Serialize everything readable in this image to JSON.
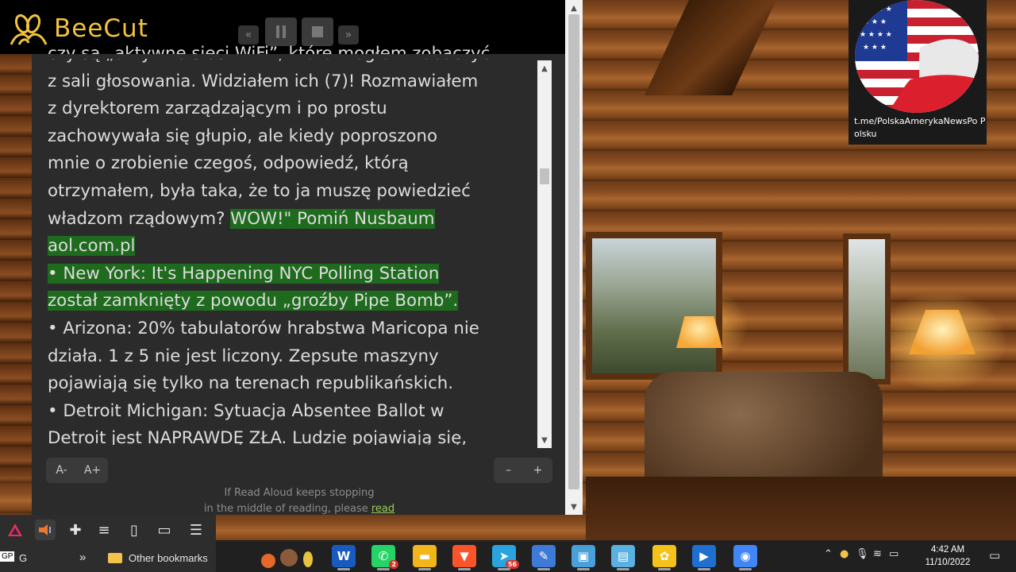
{
  "recorder": {
    "app_name": "BeeCut",
    "controls": [
      "rewind",
      "pause",
      "stop",
      "forward"
    ]
  },
  "reader": {
    "lines": [
      {
        "text": "czy są „aktywne sieci WiFi”, które mogłem zobaczyć",
        "highlight": false
      },
      {
        "text": "z sali głosowania. Widziałem ich (7)! Rozmawiałem",
        "highlight": false
      },
      {
        "text": "z dyrektorem zarządzającym i po prostu",
        "highlight": false
      },
      {
        "text": "zachowywała się głupio, ale kiedy poproszono",
        "highlight": false
      },
      {
        "text": "mnie o zrobienie czegoś, odpowiedź, którą",
        "highlight": false
      },
      {
        "text": "otrzymałem, była taka, że to ja muszę powiedzieć",
        "highlight": false
      },
      {
        "text_plain": "władzom rządowym? ",
        "text_hl": "WOW!\" Pomiń Nusbaum",
        "mixed": true
      },
      {
        "text": "aol.com.pl",
        "highlight": true
      },
      {
        "text": "• New York: It's Happening NYC Polling Station",
        "highlight": true
      },
      {
        "text": "został zamknięty z powodu „groźby Pipe Bomb”.",
        "highlight": true
      },
      {
        "text": "• Arizona: 20% tabulatorów hrabstwa Maricopa nie",
        "highlight": false
      },
      {
        "text": "działa. 1 z 5 nie jest liczony. Zepsute maszyny",
        "highlight": false
      },
      {
        "text": "pojawiają się tylko na terenach republikańskich.",
        "highlight": false
      },
      {
        "text": "• Detroit Michigan: Sytuacja Absentee Ballot w",
        "highlight": false
      },
      {
        "text": "Detroit jest NAPRAWDĘ ZŁA. Ludzie pojawiają się,",
        "highlight": false
      }
    ],
    "font_decrease": "A-",
    "font_increase": "A+",
    "zoom_out": "–",
    "zoom_in": "+",
    "notice_line1": "If Read Aloud keeps stopping",
    "notice_line2_prefix": "in the middle of reading, please ",
    "notice_link": "read"
  },
  "badge": {
    "channel_text": "t.me/PolskaAmerykaNewsPo Polsku"
  },
  "browser": {
    "extensions": [
      "prisma-icon",
      "read-aloud-icon",
      "puzzle-icon",
      "playlist-icon",
      "sidebar-icon",
      "wallet-icon",
      "menu-icon"
    ],
    "bookmark_left_label": "G",
    "bookmark_left_prefix": "GP",
    "bookmark_overflow": "»",
    "other_bookmarks": "Other bookmarks"
  },
  "taskbar": {
    "apps": [
      {
        "name": "word-icon",
        "color": "#185abd",
        "glyph": "W"
      },
      {
        "name": "whatsapp-icon",
        "color": "#25d366",
        "glyph": "✆",
        "badge": "2"
      },
      {
        "name": "file-explorer-icon",
        "color": "#f2b61b",
        "glyph": "▬"
      },
      {
        "name": "brave-icon",
        "color": "#fb542b",
        "glyph": "▼"
      },
      {
        "name": "telegram-icon",
        "color": "#2aa3df",
        "glyph": "➤",
        "badge": "56"
      },
      {
        "name": "paint-icon",
        "color": "#3d7bd6",
        "glyph": "✎"
      },
      {
        "name": "photos-icon",
        "color": "#4aa0d8",
        "glyph": "▣"
      },
      {
        "name": "notepad-icon",
        "color": "#5ab0e0",
        "glyph": "▤"
      },
      {
        "name": "beecut-taskbar-icon",
        "color": "#f4c21a",
        "glyph": "✿"
      },
      {
        "name": "video-editor-icon",
        "color": "#1f6fd1",
        "glyph": "▶"
      },
      {
        "name": "chrome-icon",
        "color": "#4285f4",
        "glyph": "◉"
      }
    ],
    "time": "4:42 AM",
    "date": "11/10/2022"
  }
}
